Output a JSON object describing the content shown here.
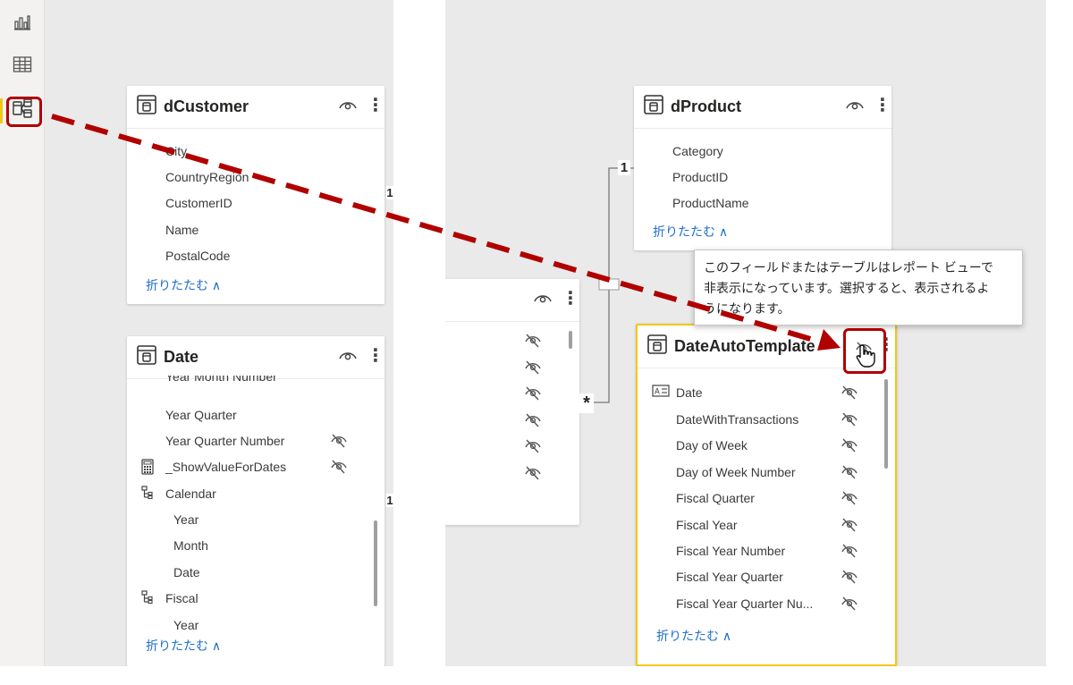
{
  "colors": {
    "accent": "#f2c811",
    "highlight": "#b00000",
    "link": "#1f6fc6",
    "canvas": "#eaeaea"
  },
  "rail": {
    "items": [
      {
        "name": "report-view",
        "icon": "bar-chart-icon"
      },
      {
        "name": "data-view",
        "icon": "table-icon"
      },
      {
        "name": "model-view",
        "icon": "model-icon",
        "active": true
      }
    ]
  },
  "dCustomer": {
    "title": "dCustomer",
    "fields": [
      "City",
      "CountryRegion",
      "CustomerID",
      "Name",
      "PostalCode"
    ],
    "collapse": "折りたたむ ∧"
  },
  "date": {
    "title": "Date",
    "partial_field": "Year Month Number",
    "fields": [
      {
        "label": "Year Quarter"
      },
      {
        "label": "Year Quarter Number",
        "hidden": true
      },
      {
        "label": "_ShowValueForDates",
        "hidden": true,
        "icon": "calculator-icon"
      },
      {
        "label": "Calendar",
        "icon": "hierarchy-icon"
      },
      {
        "label": "Year",
        "indent": true
      },
      {
        "label": "Month",
        "indent": true
      },
      {
        "label": "Date",
        "indent": true
      },
      {
        "label": "Fiscal",
        "icon": "hierarchy-icon"
      },
      {
        "label": "Year",
        "indent": true
      }
    ],
    "collapse": "折りたたむ ∧"
  },
  "dProduct": {
    "title": "dProduct",
    "fields": [
      "Category",
      "ProductID",
      "ProductName"
    ],
    "collapse": "折りたたむ ∧"
  },
  "dateAutoTemplate": {
    "title": "DateAutoTemplate",
    "fields": [
      {
        "label": "Date",
        "icon": "text-field-icon"
      },
      {
        "label": "DateWithTransactions"
      },
      {
        "label": "Day of Week"
      },
      {
        "label": "Day of Week Number"
      },
      {
        "label": "Fiscal Quarter"
      },
      {
        "label": "Fiscal Year"
      },
      {
        "label": "Fiscal Year Number"
      },
      {
        "label": "Fiscal Year Quarter"
      },
      {
        "label": "Fiscal Year Quarter Nu..."
      }
    ],
    "collapse": "折りたたむ ∧"
  },
  "relationship": {
    "one": "1",
    "many": "*",
    "one_left": "1",
    "one_left_2": "1"
  },
  "tooltip": {
    "lines": [
      "このフィールドまたはテーブルはレポート ビューで",
      "非表示になっています。選択すると、表示されるよ",
      "うになります。"
    ]
  }
}
